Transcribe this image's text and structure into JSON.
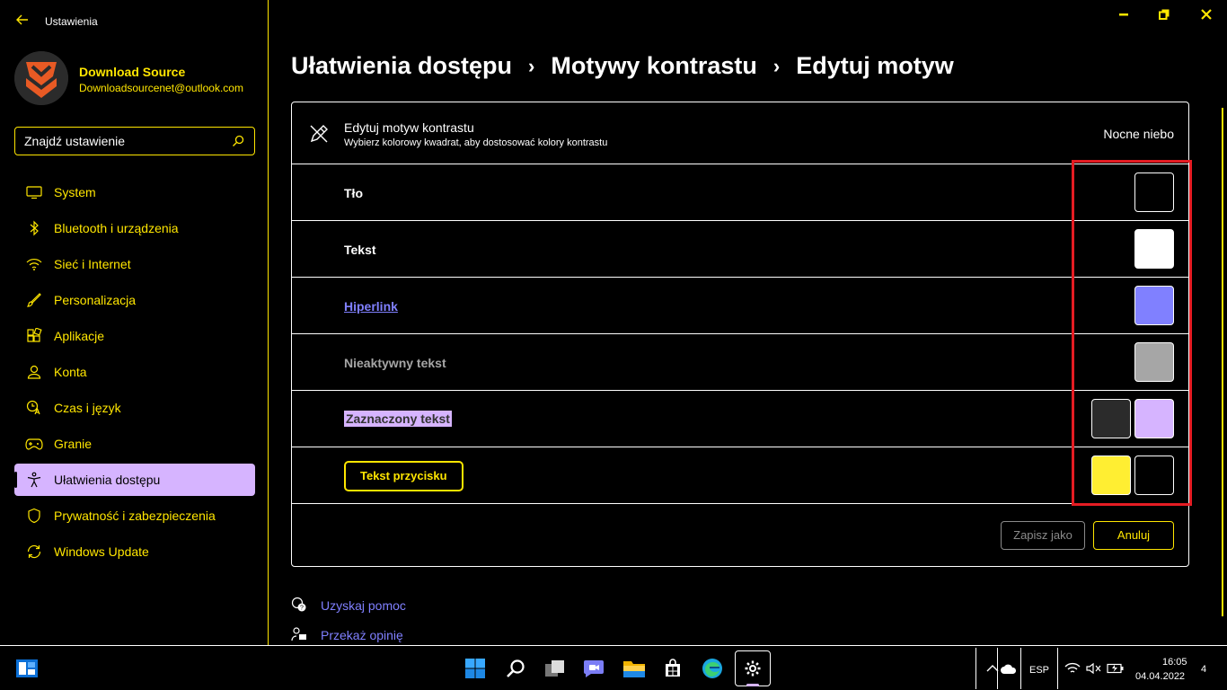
{
  "window": {
    "title": "Ustawienia",
    "back_icon": "arrow-left-icon",
    "minimize_icon": "minimize-icon",
    "restore_icon": "restore-icon",
    "close_icon": "close-icon"
  },
  "user": {
    "name": "Download Source",
    "email": "Downloadsourcenet@outlook.com"
  },
  "search": {
    "value": "Znajdź ustawienie"
  },
  "sidebar": {
    "items": [
      {
        "label": "System",
        "icon": "monitor-icon"
      },
      {
        "label": "Bluetooth i urządzenia",
        "icon": "bluetooth-icon"
      },
      {
        "label": "Sieć i Internet",
        "icon": "wifi-icon"
      },
      {
        "label": "Personalizacja",
        "icon": "brush-icon"
      },
      {
        "label": "Aplikacje",
        "icon": "apps-icon"
      },
      {
        "label": "Konta",
        "icon": "person-icon"
      },
      {
        "label": "Czas i język",
        "icon": "clock-language-icon"
      },
      {
        "label": "Granie",
        "icon": "gamepad-icon"
      },
      {
        "label": "Ułatwienia dostępu",
        "icon": "accessibility-icon",
        "active": true
      },
      {
        "label": "Prywatność i zabezpieczenia",
        "icon": "shield-icon"
      },
      {
        "label": "Windows Update",
        "icon": "update-icon"
      }
    ]
  },
  "breadcrumb": {
    "items": [
      "Ułatwienia dostępu",
      "Motywy kontrastu",
      "Edytuj motyw"
    ],
    "separator": "›"
  },
  "card": {
    "title": "Edytuj motyw kontrastu",
    "subtitle": "Wybierz kolorowy kwadrat, aby dostosować kolory kontrastu",
    "theme_name": "Nocne niebo",
    "rows": [
      {
        "label": "Tło",
        "swatches": [
          "#000000"
        ]
      },
      {
        "label": "Tekst",
        "swatches": [
          "#ffffff"
        ]
      },
      {
        "label": "Hiperlink",
        "swatches": [
          "#8080ff"
        ]
      },
      {
        "label": "Nieaktywny tekst",
        "swatches": [
          "#a6a6a6"
        ]
      },
      {
        "label": "Zaznaczony tekst",
        "swatches": [
          "#2b2b2b",
          "#d6b4ff"
        ]
      },
      {
        "label": "Tekst przycisku",
        "swatches": [
          "#ffee32",
          "#000000"
        ]
      }
    ],
    "save_label": "Zapisz jako",
    "cancel_label": "Anuluj"
  },
  "links": {
    "help": "Uzyskaj pomoc",
    "feedback": "Przekaż opinię"
  },
  "colors": {
    "accent": "#ffe600",
    "selection": "#d6b4ff",
    "hyperlink": "#8080ff",
    "highlight": "#e51c23"
  },
  "taskbar": {
    "language": "ESP",
    "time": "16:05",
    "date": "04.04.2022",
    "notification_count": "4"
  }
}
